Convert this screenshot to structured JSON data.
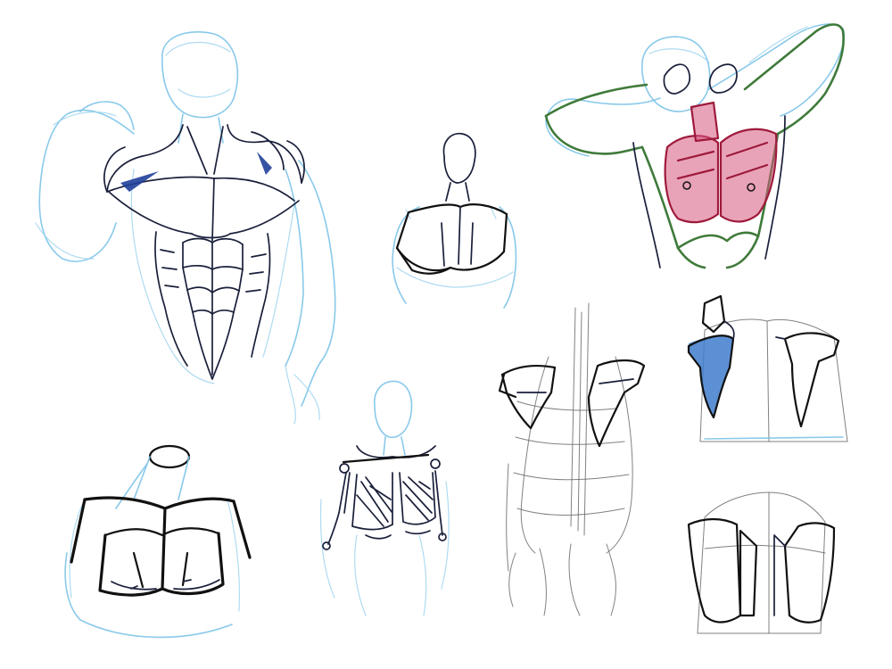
{
  "sheet": {
    "background": "#ffffff",
    "colors": {
      "light_blue_pencil": "#7cc3e8",
      "ink": "#111111",
      "green_marker": "#3f7a3a",
      "red_marker": "#9e1a3c",
      "pink_fill": "#d7587e",
      "blue_fill": "#3f7ccc"
    },
    "sketches": [
      {
        "id": "torso-front-muscles"
      },
      {
        "id": "chest-block-small"
      },
      {
        "id": "torso-arms-raised-colored"
      },
      {
        "id": "spine-ribcage-shoulder-blades"
      },
      {
        "id": "shoulder-blades-blue"
      },
      {
        "id": "chest-block-cylinder-neck"
      },
      {
        "id": "skeleton-pectoral-fans"
      },
      {
        "id": "back-blades-bottom-right"
      }
    ]
  }
}
